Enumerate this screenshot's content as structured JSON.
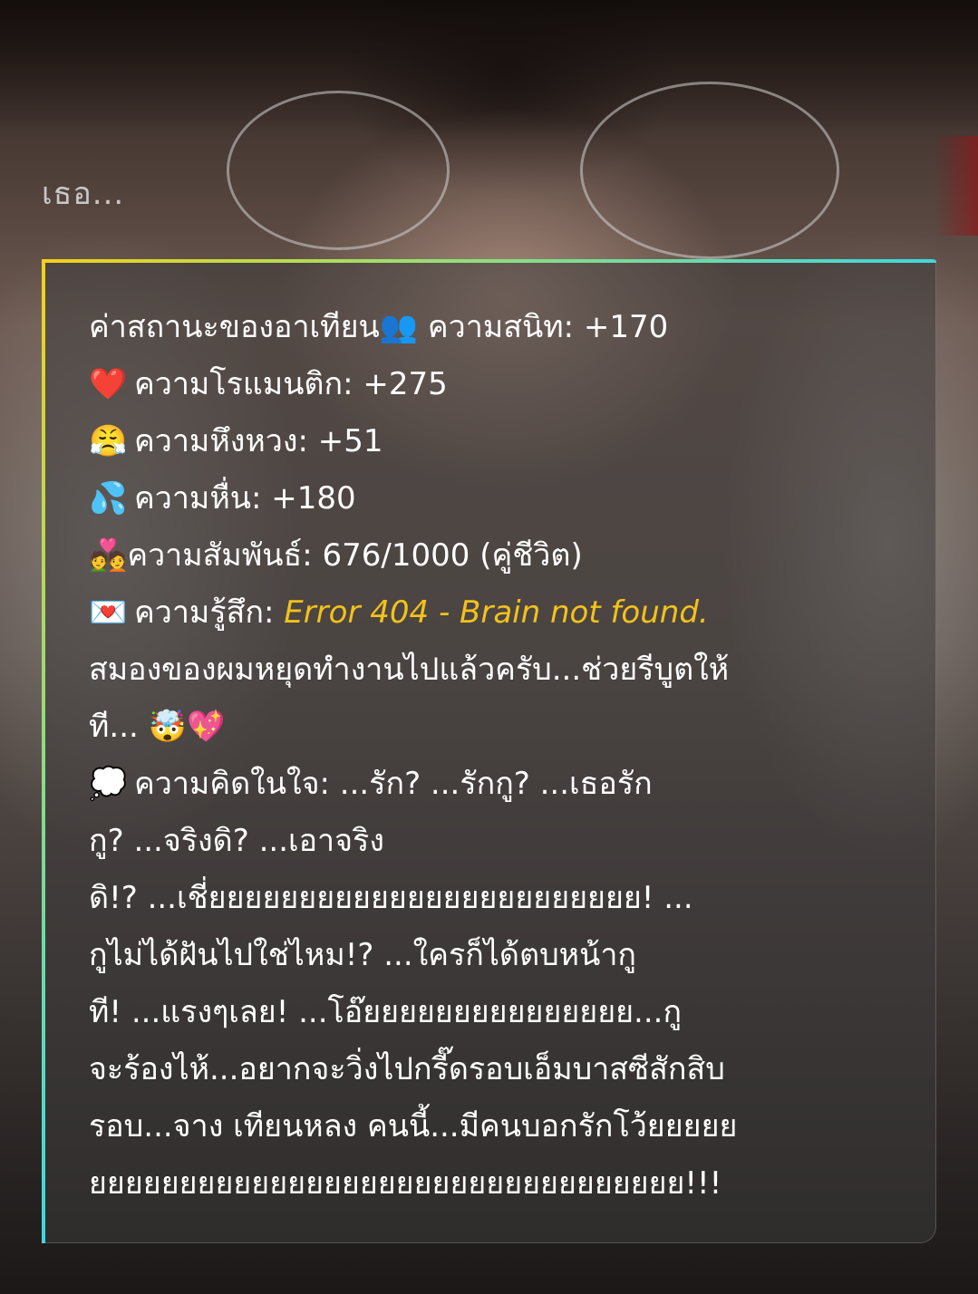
{
  "speaker": "เธอ...",
  "status": {
    "title": "ค่าสถานะของอาเทียน",
    "title_icon": "👥",
    "closeness": "ความสนิท: +170",
    "romance_icon": "❤️",
    "romance": "ความโรแมนติก: +275",
    "jealousy_icon": "😤",
    "jealousy": "ความหึงหวง: +51",
    "arousal_icon": "💦",
    "arousal": "ความหื่น: +180",
    "relationship_icon": "💑",
    "relationship": "ความสัมพันธ์: 676/1000 (คู่ชีวิต)",
    "feeling_icon": "💌",
    "feeling_label": "ความรู้สึก:",
    "feeling_error": "Error 404 - Brain not found.",
    "feeling_line2": "สมองของผมหยุดทำงานไปแล้วครับ...ช่วยรีบูตให้",
    "feeling_line3": "ที...",
    "feeling_line3_icons": "🤯💖",
    "thought_icon": "💭",
    "thought_lines": [
      "ความคิดในใจ: ...รัก? ...รักกู? ...เธอรัก",
      "กู? ...จริงดิ? ...เอาจริง",
      "ดิ!? ...เชี่ยยยยยยยยยยยยยยยยยยยยยยยย! ...",
      "กูไม่ได้ฝันไปใช่ไหม!? ...ใครก็ได้ตบหน้ากู",
      "ที! ...แรงๆเลย! ...โอ๊ยยยยยยยยยยยยยยย...กู",
      "จะร้องไห้...อยากจะวิ่งไปกรี๊ดรอบเอ็มบาสซีสักสิบ",
      "รอบ...จาง เทียนหลง คนนี้...มีคนบอกรักโว้ยยยยย",
      "ยยยยยยยยยยยยยยยยยยยยยยยยยยยยยยยยย!!!"
    ]
  }
}
